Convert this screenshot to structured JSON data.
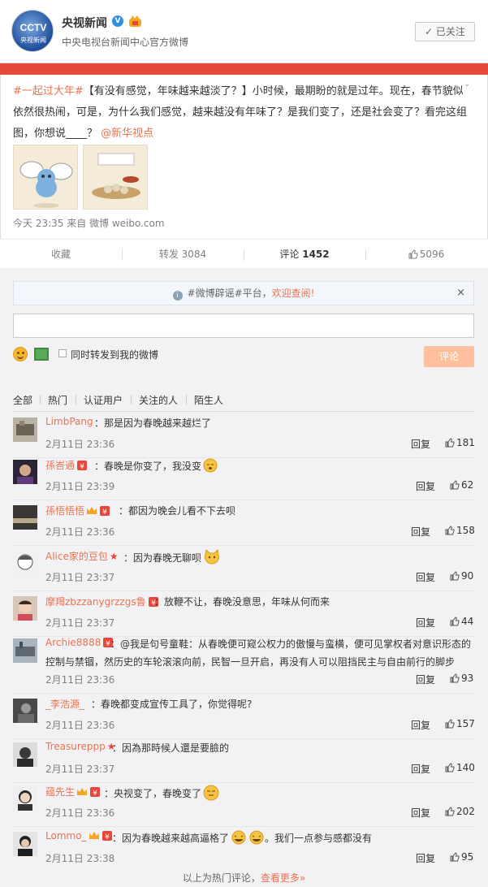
{
  "profile": {
    "avatar_text": "CCTV",
    "avatar_sub": "央视新闻",
    "name": "央视新闻",
    "verified_badge": "V",
    "description": "中央电视台新闻中心官方微博",
    "follow_label": "已关注"
  },
  "post": {
    "topic": "#一起过大年#",
    "text": "【有没有感觉，年味越来越淡了？】小时候，最期盼的就是过年。现在，春节貌似依然很热闹，可是，为什么我们感觉，越来越没有年味了？是我们变了，还是社会变了？看完这组图，你想说____？",
    "mention": "@新华视点",
    "meta": "今天 23:35 来自 微博 weibo.com"
  },
  "actions": {
    "collect": "收藏",
    "repost": "转发 3084",
    "comment": "评论",
    "comment_count": "1452",
    "like": "5096"
  },
  "composer": {
    "notice_prefix": "#微博辟谣#平台，",
    "notice_link": "欢迎查阅!",
    "close": "×",
    "forward_label": "同时转发到我的微博",
    "submit": "评论"
  },
  "filters": [
    "全部",
    "热门",
    "认证用户",
    "关注的人",
    "陌生人"
  ],
  "comments": [
    {
      "user": "LimbPang",
      "text": "：那是因为春晚越来越烂了",
      "time": "2月11日 23:36",
      "reply": "回复",
      "likes": "181"
    },
    {
      "user": "孫峇通",
      "text": "：春晚是你变了，我没变",
      "time": "2月11日 23:39",
      "reply": "回复",
      "likes": "62"
    },
    {
      "user": "孫悟悟悟",
      "text": "：都因为晚会儿看不下去呗",
      "time": "2月11日 23:36",
      "reply": "回复",
      "likes": "158"
    },
    {
      "user": "Alice家的豆包",
      "text": "：因为春晚无聊呗",
      "time": "2月11日 23:37",
      "reply": "回复",
      "likes": "90"
    },
    {
      "user": "摩羯zbzzanygrzzgs鲁",
      "text": "：放鞭不让，春晚没意思，年味从何而来",
      "time": "2月11日 23:37",
      "reply": "回复",
      "likes": "44"
    },
    {
      "user": "Archie8888",
      "text": "：@我是句号童鞋：从春晚便可窥公权力的傲慢与蛮横，便可见掌权者对意识形态的",
      "text2": "控制与禁锢，然历史的车轮滚滚向前，民智一旦开启，再没有人可以阻挡民主与自由前行的脚步",
      "time": "2月11日 23:36",
      "reply": "回复",
      "likes": "93"
    },
    {
      "user": "_李浩源_",
      "text": "：春晚都变成宣传工具了，你觉得呢?",
      "time": "2月11日 23:36",
      "reply": "回复",
      "likes": "157"
    },
    {
      "user": "Treasureppp",
      "text": "：因為那時候人還是要臉的",
      "time": "2月11日 23:37",
      "reply": "回复",
      "likes": "140"
    },
    {
      "user": "蕴先生",
      "text": "：央视变了，春晚变了",
      "time": "2月11日 23:36",
      "reply": "回复",
      "likes": "202"
    },
    {
      "user": "Lommo_",
      "text": "：因为春晚越来越高逼格了",
      "text3": "。我们一点参与感都没有",
      "time": "2月11日 23:38",
      "reply": "回复",
      "likes": "95"
    }
  ],
  "footer": {
    "prefix": "以上为热门评论，",
    "link": "查看更多»"
  }
}
